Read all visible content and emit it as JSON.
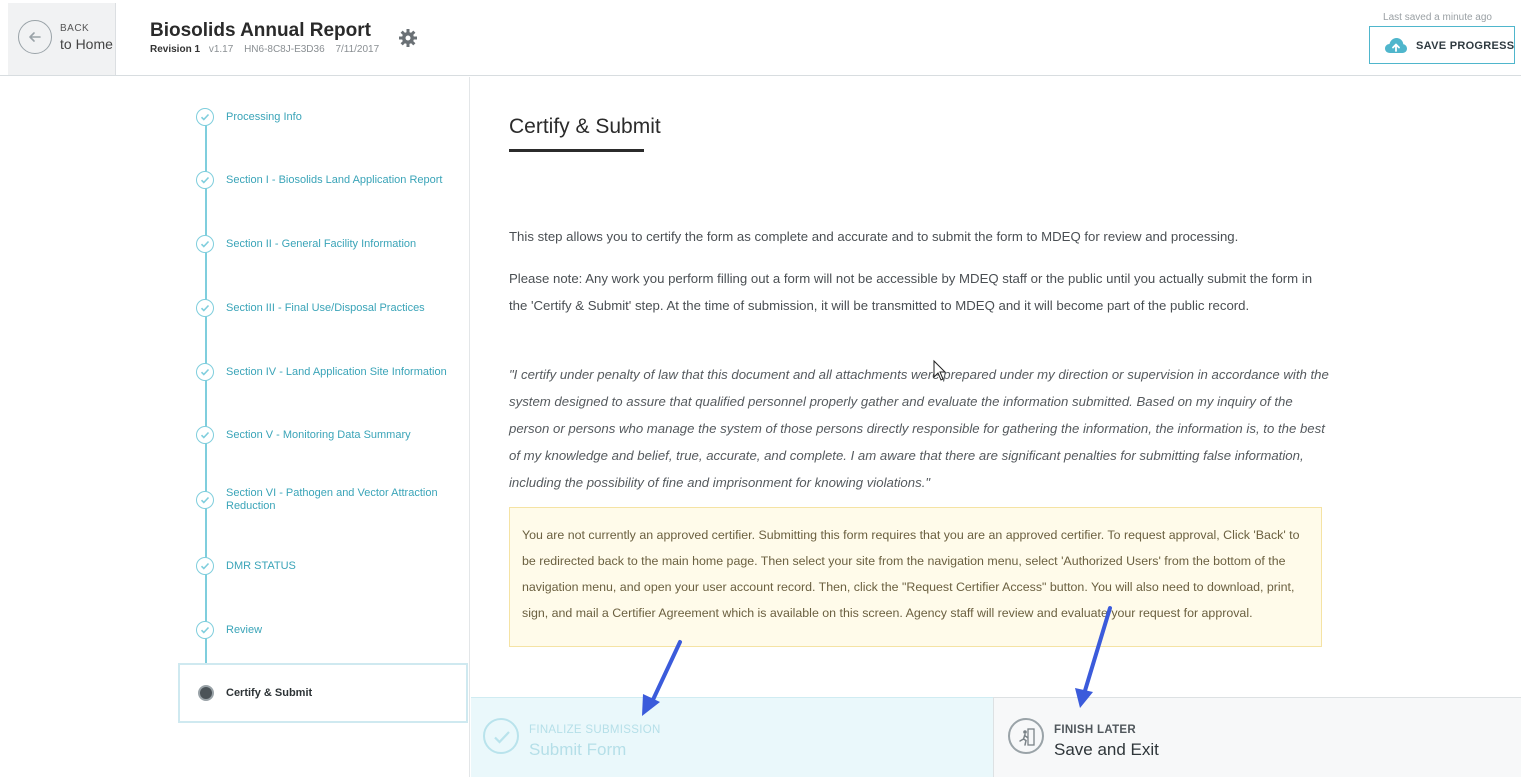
{
  "header": {
    "back_small": "BACK",
    "back_big": "to Home",
    "title": "Biosolids Annual Report",
    "revision": "Revision 1",
    "version": "v1.17",
    "form_id": "HN6-8C8J-E3D36",
    "date": "7/11/2017",
    "last_saved": "Last saved a minute ago",
    "save_label": "SAVE PROGRESS"
  },
  "sidebar": {
    "steps": [
      {
        "label": "Processing Info"
      },
      {
        "label": "Section I - Biosolids Land Application Report"
      },
      {
        "label": "Section II - General Facility Information"
      },
      {
        "label": "Section III - Final Use/Disposal Practices"
      },
      {
        "label": "Section IV - Land Application Site Information"
      },
      {
        "label": "Section V - Monitoring Data Summary"
      },
      {
        "label": "Section VI - Pathogen and Vector Attraction Reduction"
      },
      {
        "label": "DMR STATUS"
      },
      {
        "label": "Review"
      }
    ],
    "current_step": "Certify & Submit"
  },
  "main": {
    "title": "Certify & Submit",
    "para1": "This step allows you to certify the form as complete and accurate and to submit the form to MDEQ for review and processing.",
    "para2": "Please note: Any work you perform filling out a form will not be accessible by MDEQ staff or the public until you actually submit the form in the 'Certify & Submit' step. At the time of submission, it will be transmitted to MDEQ and it will become part of the public record.",
    "certification": "\"I certify under penalty of law that this document and all attachments were prepared under my direction or supervision in accordance with the system designed to assure that qualified personnel properly gather and evaluate the information submitted.  Based on my inquiry of the person or persons who manage the system of those persons directly responsible for gathering the information, the information is, to the best of my knowledge and belief, true, accurate, and complete.  I am aware that there are significant penalties for submitting false information, including the possibility of fine and imprisonment for knowing violations.\"",
    "warning": "You are not currently an approved certifier. Submitting this form requires that you are an approved certifier. To request approval, Click 'Back' to be redirected back to the main home page. Then select your site from the navigation menu, select 'Authorized Users' from the bottom of the navigation menu, and open your user account record. Then, click the \"Request Certifier Access\" button. You will also need to download, print, sign, and mail a Certifier Agreement which is available on this screen. Agency staff will review and evaluate your request for approval."
  },
  "bottom": {
    "finalize_small": "FINALIZE SUBMISSION",
    "finalize_big": "Submit Form",
    "finish_small": "FINISH LATER",
    "finish_big": "Save and Exit"
  },
  "colors": {
    "accent": "#4fb6cc",
    "step_teal": "#3aa4b8",
    "warning_bg": "#fffbea",
    "arrow_blue": "#3b5bdb"
  }
}
